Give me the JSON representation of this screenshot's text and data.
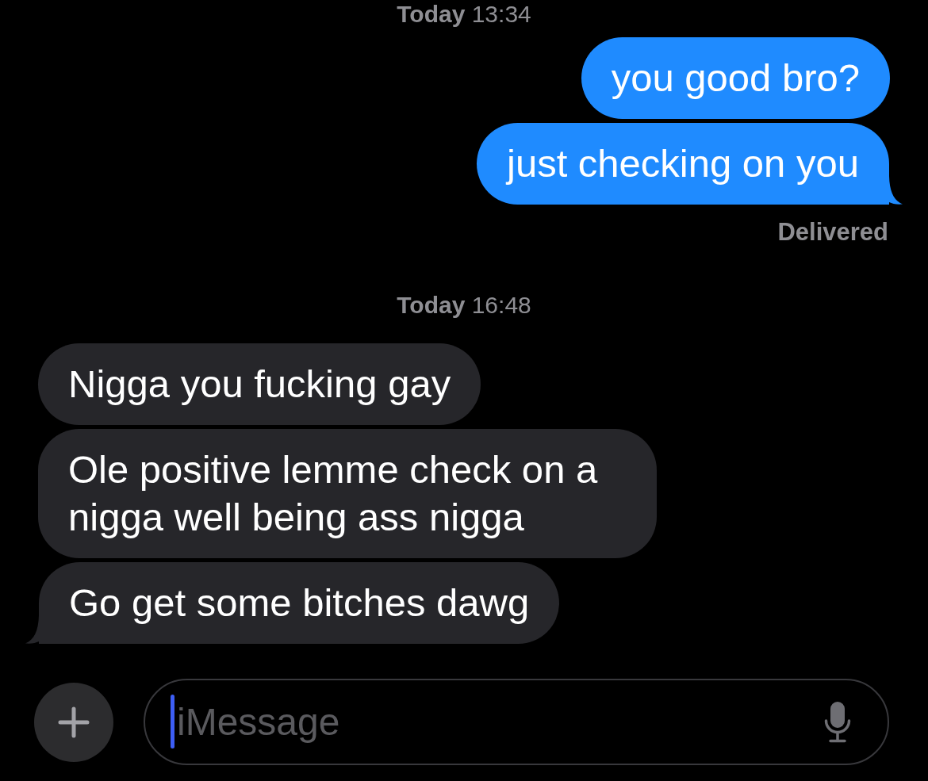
{
  "thread": [
    {
      "kind": "timestamp",
      "text": "**Today** 13:34"
    },
    {
      "kind": "outgoing",
      "tail": false,
      "text": "you good bro?"
    },
    {
      "kind": "outgoing",
      "tail": true,
      "text": "just checking on you"
    },
    {
      "kind": "status",
      "text": "Delivered"
    },
    {
      "kind": "timestamp",
      "text": "**Today** 16:48"
    },
    {
      "kind": "incoming",
      "tail": false,
      "text": "Nigga you fucking gay"
    },
    {
      "kind": "incoming",
      "tail": false,
      "text": "Ole positive lemme check on a nigga well being ass nigga"
    },
    {
      "kind": "incoming",
      "tail": true,
      "text": "Go get some bitches dawg"
    }
  ],
  "composer": {
    "placeholder": "iMessage",
    "focused": true
  }
}
